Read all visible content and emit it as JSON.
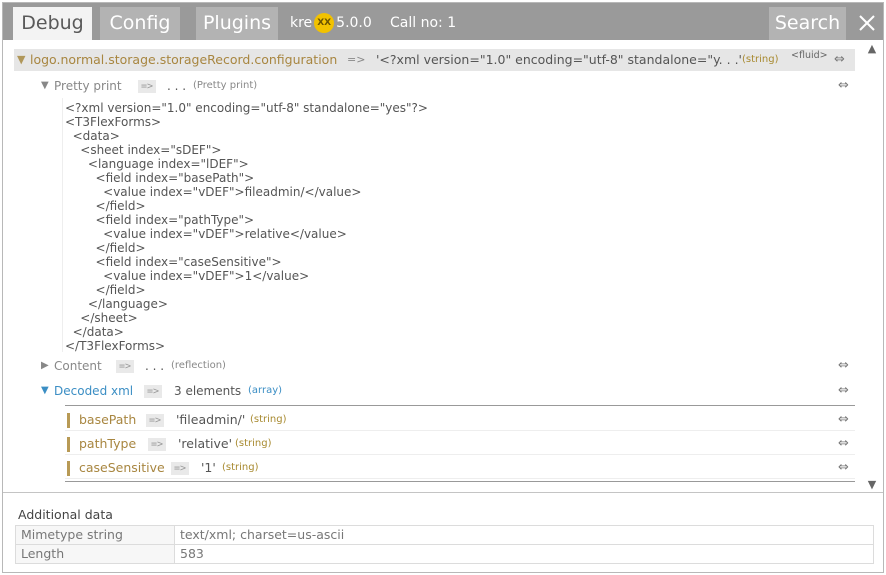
{
  "header": {
    "tabs": [
      {
        "label": "Debug",
        "active": true
      },
      {
        "label": "Config",
        "active": false
      },
      {
        "label": "Plugins",
        "active": false
      }
    ],
    "brand_prefix": "kre",
    "brand_badge": "XX",
    "version": "5.0.0",
    "call_no": "Call no: 1",
    "search_label": "Search",
    "close_icon": "close-icon"
  },
  "main": {
    "path": "logo.normal.storage.storageRecord.configuration",
    "arrow": "=>",
    "value": "'<?xml version=\"1.0\" encoding=\"utf-8\" standalone=\"y. . .'",
    "type": "(string)",
    "fluid": "<fluid>",
    "expand_icon": "⇔"
  },
  "pretty_print": {
    "label": "Pretty print",
    "arrow": "=>",
    "dots": ". . .",
    "hint": "(Pretty print)",
    "lines": [
      "<?xml version=\"1.0\" encoding=\"utf-8\" standalone=\"yes\"?>",
      "<T3FlexForms>",
      "  <data>",
      "    <sheet index=\"sDEF\">",
      "      <language index=\"lDEF\">",
      "        <field index=\"basePath\">",
      "          <value index=\"vDEF\">fileadmin/</value>",
      "        </field>",
      "        <field index=\"pathType\">",
      "          <value index=\"vDEF\">relative</value>",
      "        </field>",
      "        <field index=\"caseSensitive\">",
      "          <value index=\"vDEF\">1</value>",
      "        </field>",
      "      </language>",
      "    </sheet>",
      "  </data>",
      "</T3FlexForms>"
    ]
  },
  "content": {
    "label": "Content",
    "arrow": "=>",
    "dots": ". . .",
    "hint": "(reflection)"
  },
  "decoded_xml": {
    "label": "Decoded xml",
    "arrow": "=>",
    "count": "3 elements",
    "type": "(array)",
    "elements": [
      {
        "name": "basePath",
        "arrow": "=>",
        "value": "'fileadmin/'",
        "type": "(string)"
      },
      {
        "name": "pathType",
        "arrow": "=>",
        "value": "'relative'",
        "type": "(string)"
      },
      {
        "name": "caseSensitive",
        "arrow": "=>",
        "value": "'1'",
        "type": "(string)"
      }
    ]
  },
  "additional": {
    "title": "Additional data",
    "rows": [
      {
        "key": "Mimetype string",
        "value": "text/xml; charset=us-ascii"
      },
      {
        "key": "Length",
        "value": "583"
      }
    ]
  },
  "colors": {
    "header_bg": "#9a9a9a",
    "tab_inactive": "#b3b3b3",
    "tab_active": "#f3f3f3",
    "accent_gold": "#a88640",
    "accent_blue": "#3b8ec4",
    "badge": "#f2c200"
  }
}
